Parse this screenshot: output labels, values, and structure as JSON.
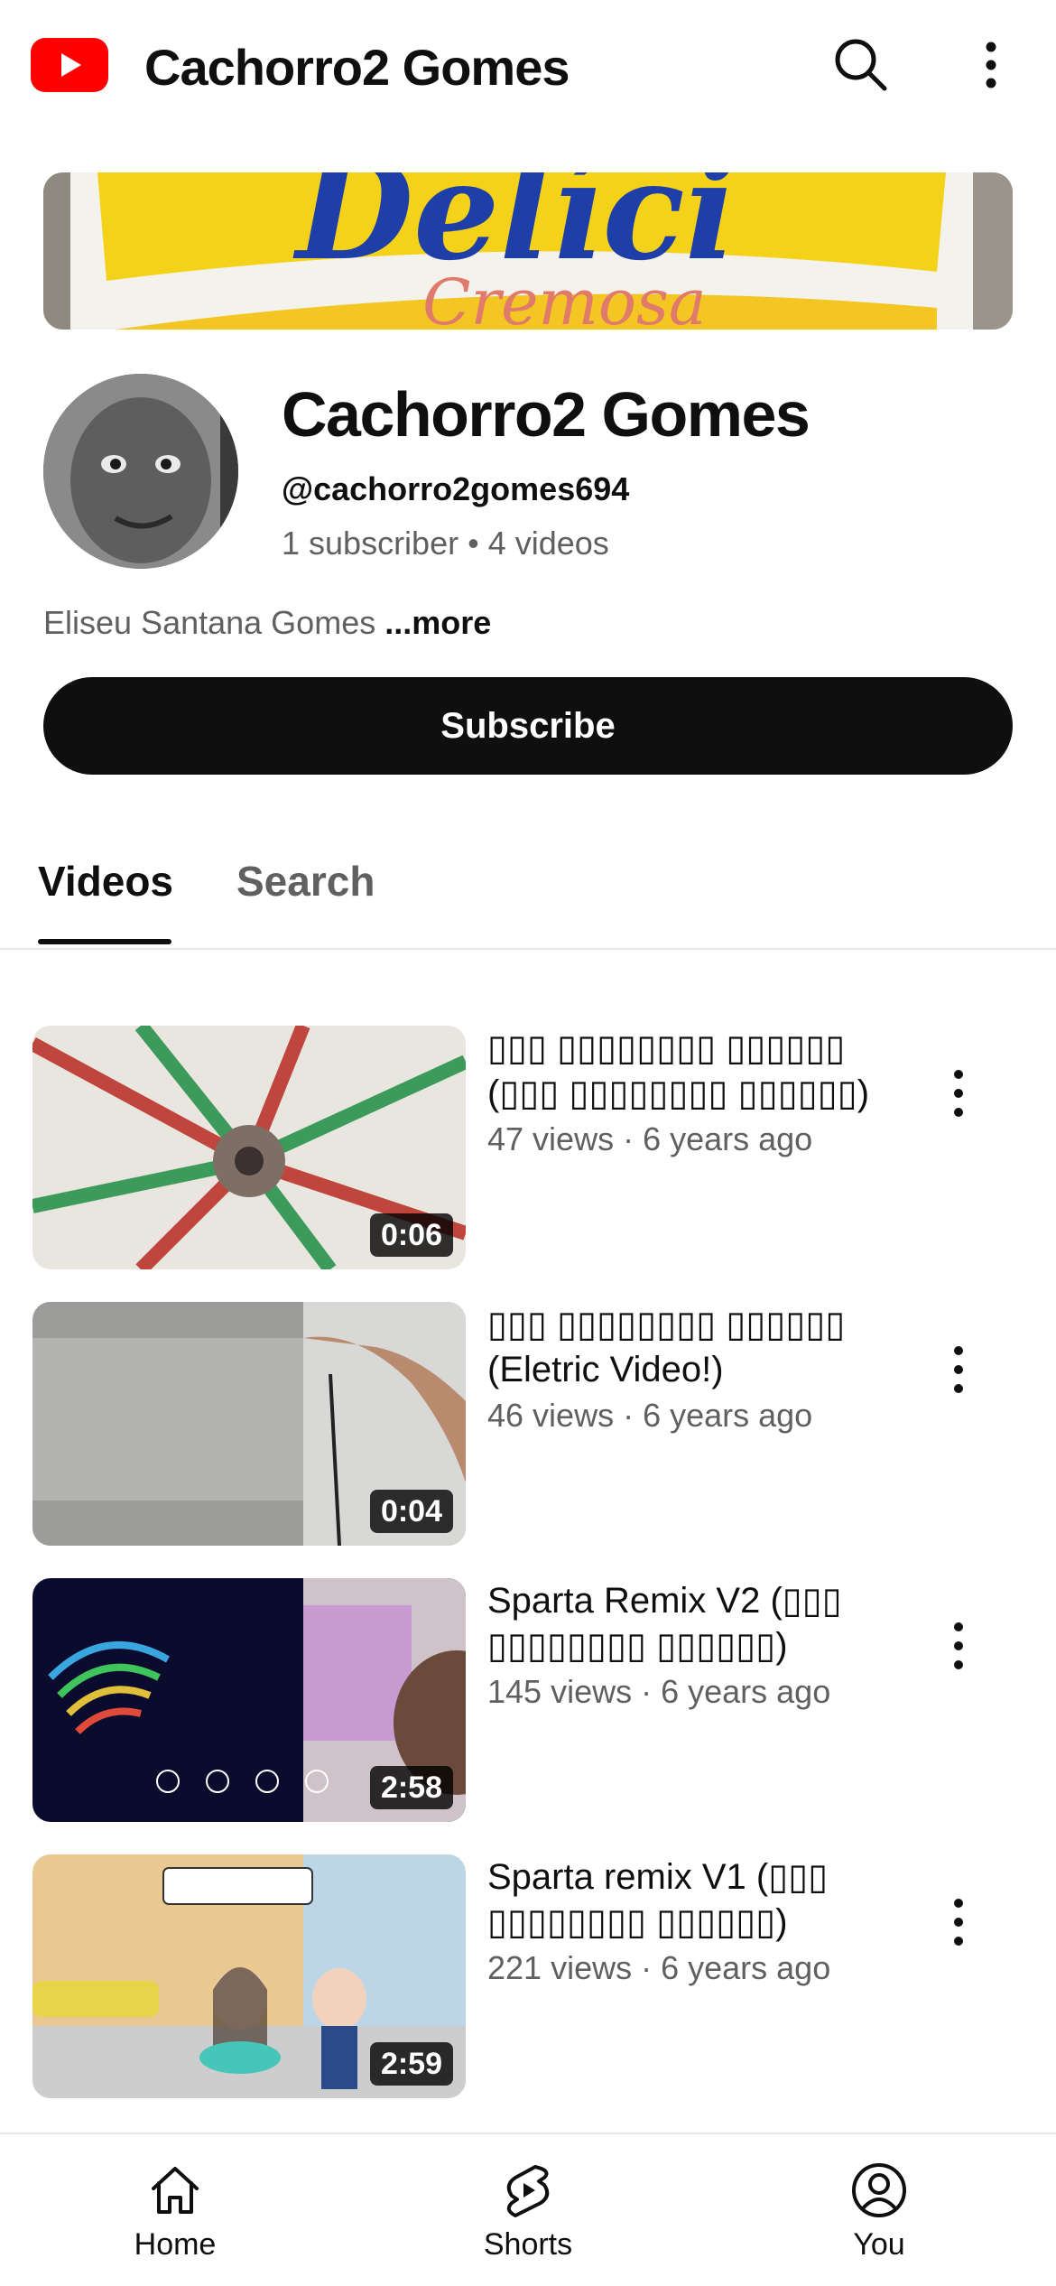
{
  "topbar": {
    "title": "Cachorro2 Gomes",
    "logo_icon": "youtube-logo-icon",
    "brand_color": "#ff0000"
  },
  "channel": {
    "name": "Cachorro2 Gomes",
    "handle": "@cachorro2gomes694",
    "subscribers": "1 subscriber",
    "video_count": "4 videos",
    "description": "Eliseu Santana Gomes",
    "more_label": "...more",
    "subscribe_label": "Subscribe"
  },
  "tabs": [
    {
      "label": "Videos",
      "active": true
    },
    {
      "label": "Search",
      "active": false
    }
  ],
  "videos": [
    {
      "title": "▯▯▯ ▯▯▯▯▯▯▯▯ ▯▯▯▯▯▯ (▯▯▯ ▯▯▯▯▯▯▯▯ ▯▯▯▯▯▯)",
      "views": "47 views",
      "age": "6 years ago",
      "duration": "0:06"
    },
    {
      "title": "▯▯▯ ▯▯▯▯▯▯▯▯ ▯▯▯▯▯▯ (Eletric Video!)",
      "views": "46 views",
      "age": "6 years ago",
      "duration": "0:04"
    },
    {
      "title": "Sparta Remix V2 (▯▯▯ ▯▯▯▯▯▯▯▯ ▯▯▯▯▯▯)",
      "views": "145 views",
      "age": "6 years ago",
      "duration": "2:58"
    },
    {
      "title": "Sparta remix V1 (▯▯▯ ▯▯▯▯▯▯▯▯ ▯▯▯▯▯▯)",
      "views": "221 views",
      "age": "6 years ago",
      "duration": "2:59"
    }
  ],
  "bottom_nav": [
    {
      "label": "Home",
      "icon": "home-icon"
    },
    {
      "label": "Shorts",
      "icon": "shorts-icon"
    },
    {
      "label": "You",
      "icon": "account-icon"
    }
  ]
}
